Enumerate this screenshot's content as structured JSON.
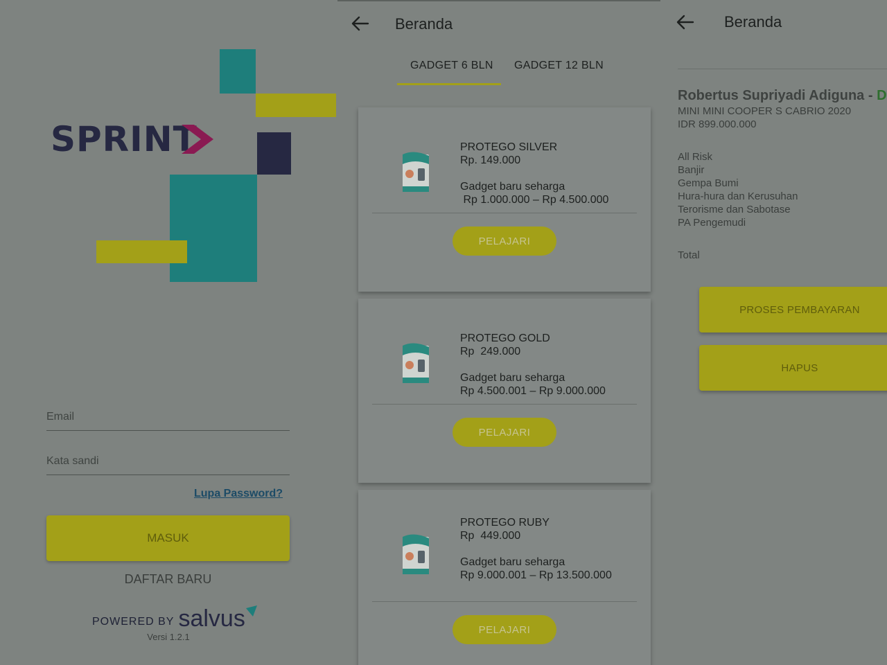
{
  "login": {
    "logo_text": "SPRINT",
    "email_placeholder": "Email",
    "password_placeholder": "Kata sandi",
    "forgot_password": "Lupa Password?",
    "login_button": "MASUK",
    "register": "DAFTAR BARU",
    "powered_by": "POWERED BY",
    "brand": "salvus",
    "version": "Versi 1.2.1"
  },
  "products": {
    "title": "Beranda",
    "tabs": [
      "GADGET 6 BLN",
      "GADGET 12 BLN"
    ],
    "active_tab": "GADGET 6 BLN",
    "cards": [
      {
        "name": "PROTEGO SILVER",
        "price": "Rp. 149.000",
        "desc": "Gadget baru seharga",
        "range": " Rp 1.000.000 – Rp 4.500.000",
        "button": "PELAJARI"
      },
      {
        "name": "PROTEGO GOLD",
        "price": "Rp  249.000",
        "desc": "Gadget baru seharga",
        "range": "Rp 4.500.001 – Rp 9.000.000",
        "button": "PELAJARI"
      },
      {
        "name": "PROTEGO RUBY",
        "price": "Rp  449.000",
        "desc": "Gadget baru seharga",
        "range": "Rp 9.000.001 – Rp 13.500.000",
        "button": "PELAJARI"
      }
    ]
  },
  "detail": {
    "title": "Beranda",
    "customer_name": "Robertus Supriyadi Adiguna - ",
    "customer_status": "Dit",
    "vehicle": "MINI MINI COOPER S CABRIO 2020",
    "value": "IDR 899.000.000",
    "coverages": [
      "All Risk",
      "Banjir",
      "Gempa Bumi",
      "Hura-hura dan Kerusuhan",
      "Terorisme dan Sabotase",
      "PA Pengemudi"
    ],
    "total_label": "Total",
    "pay_button": "PROSES PEMBAYARAN",
    "delete_button": "HAPUS"
  },
  "colors": {
    "overlay_background": "#7e8380",
    "accent_yellow": "#a3a018",
    "logo_navy": "#262842",
    "logo_teal": "#1e7e7b",
    "logo_magenta": "#8a1a52"
  }
}
